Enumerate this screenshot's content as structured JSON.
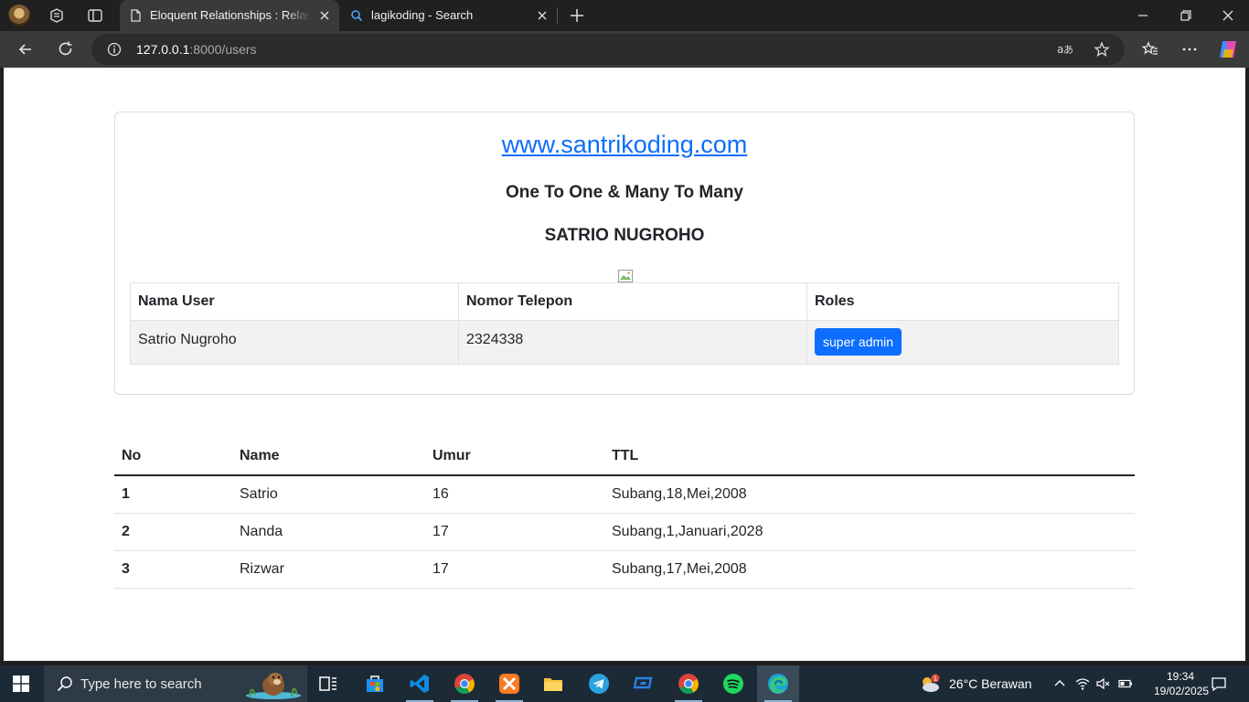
{
  "browser": {
    "tabs": [
      {
        "title": "Eloquent Relationships : Relasi One To One & Many To Many",
        "active": true
      },
      {
        "title": "lagikoding - Search",
        "active": false
      }
    ],
    "url_host": "127.0.0.1",
    "url_path": ":8000/users"
  },
  "page": {
    "site_link": "www.santrikoding.com",
    "subtitle": "One To One & Many To Many",
    "person_name": "SATRIO NUGROHO",
    "user_table": {
      "headers": [
        "Nama User",
        "Nomor Telepon",
        "Roles"
      ],
      "row": {
        "name": "Satrio Nugroho",
        "phone": "2324338",
        "role": "super admin"
      }
    },
    "data_table": {
      "headers": [
        "No",
        "Name",
        "Umur",
        "TTL"
      ],
      "rows": [
        {
          "no": "1",
          "name": "Satrio",
          "umur": "16",
          "ttl": "Subang,18,Mei,2008"
        },
        {
          "no": "2",
          "name": "Nanda",
          "umur": "17",
          "ttl": "Subang,1,Januari,2028"
        },
        {
          "no": "3",
          "name": "Rizwar",
          "umur": "17",
          "ttl": "Subang,17,Mei,2008"
        }
      ]
    }
  },
  "taskbar": {
    "search_placeholder": "Type here to search",
    "weather": "26°C  Berawan",
    "weather_badge": "1",
    "time": "19:34",
    "date": "19/02/2025",
    "apps": [
      "task-view-icon",
      "microsoft-store-icon",
      "vscode-icon",
      "chrome-icon",
      "xampp-icon",
      "file-explorer-icon",
      "telegram-icon",
      "remote-desktop-icon",
      "chrome-icon",
      "spotify-icon",
      "edge-icon"
    ]
  },
  "colors": {
    "link": "#0d6efd",
    "badge": "#0d6efd",
    "taskbar": "#1c2a36"
  }
}
